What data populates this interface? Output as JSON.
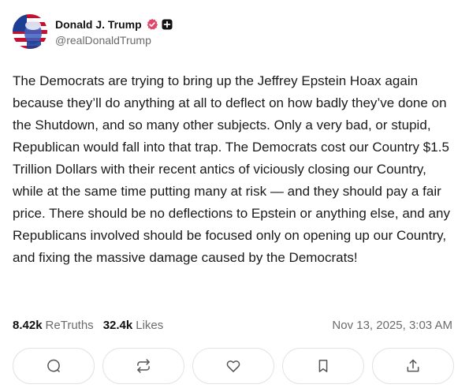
{
  "author": {
    "display_name": "Donald J. Trump",
    "handle": "@realDonaldTrump",
    "avatar_icon": "flag-portrait-avatar",
    "verified_icon": "verified-badge-icon",
    "plus_icon": "plus-badge-icon",
    "verified_color": "#e0476b"
  },
  "post": {
    "text": "The Democrats are trying to bring up the Jeffrey Epstein Hoax again because they’ll do anything at all to deflect on how badly they’ve done on the Shutdown, and so many other subjects. Only a very bad, or stupid, Republican would fall into that trap. The Democrats cost our Country $1.5 Trillion Dollars with their recent antics of viciously closing our Country, while at the same time putting many at risk — and they should pay a fair price. There should be no deflections to Epstein or anything else, and any Republicans involved should be focused only on opening up our Country, and fixing the massive damage caused by the Democrats!",
    "retruths_count": "8.42k",
    "retruths_label": "ReTruths",
    "likes_count": "32.4k",
    "likes_label": "Likes",
    "timestamp": "Nov 13, 2025, 3:03 AM"
  },
  "actions": [
    {
      "icon": "reply-icon"
    },
    {
      "icon": "retruth-icon"
    },
    {
      "icon": "like-icon"
    },
    {
      "icon": "bookmark-icon"
    },
    {
      "icon": "share-icon"
    }
  ]
}
